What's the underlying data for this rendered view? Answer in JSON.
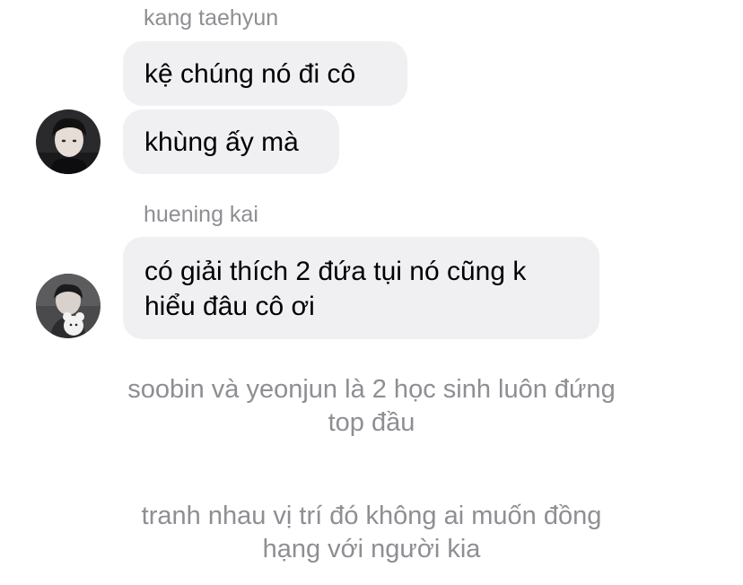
{
  "messages": [
    {
      "sender": "kang taehyun",
      "bubbles": [
        "kệ chúng nó đi cô",
        "khùng ấy mà"
      ]
    },
    {
      "sender": "huening kai",
      "bubbles": [
        "có giải thích 2 đứa tụi nó cũng k",
        "hiểu đâu cô ơi"
      ]
    }
  ],
  "system_messages": [
    {
      "lines": [
        "soobin và yeonjun là 2 học sinh luôn đứng",
        "top đầu"
      ]
    },
    {
      "lines": [
        "tranh nhau vị trí đó không ai muốn đồng",
        "hạng với người kia"
      ]
    }
  ],
  "colors": {
    "bubble_bg": "#f0f0f2",
    "muted_text": "#8e8e93",
    "message_text": "#000000"
  }
}
